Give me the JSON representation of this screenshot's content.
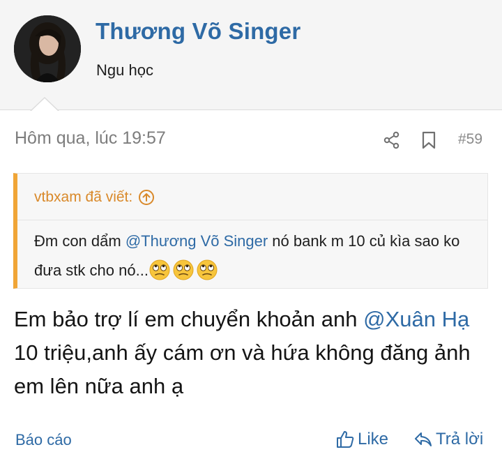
{
  "user": {
    "name": "Thương Võ Singer",
    "title": "Ngu học",
    "avatar_icon": "avatar-photo"
  },
  "post": {
    "date": "Hôm qua, lúc 19:57",
    "number": "#59",
    "share_icon": "share-icon",
    "bookmark_icon": "bookmark-icon"
  },
  "quote": {
    "author_line": "vtbxam đã viết:",
    "text_before": "Đm con dẩm ",
    "mention": "@Thương Võ Singer",
    "text_after": " nó bank m 10 củ kìa sao ko đưa stk cho nó...",
    "emoji_icon": "rolling-eyes-emoji",
    "emoji_count": 3,
    "accent_color": "#f0a537"
  },
  "message": {
    "text_before": "Em bảo trợ lí em chuyển khoản anh ",
    "mention": "@Xuân Hạ",
    "text_after": " 10 triệu,anh ấy cám ơn và hứa không đăng ảnh em lên nữa anh ạ"
  },
  "actions": {
    "report": "Báo cáo",
    "like": "Like",
    "reply": "Trả lời"
  },
  "colors": {
    "link": "#2e6aa5",
    "quote_author": "#d9892a",
    "muted": "#7d7d7d"
  }
}
